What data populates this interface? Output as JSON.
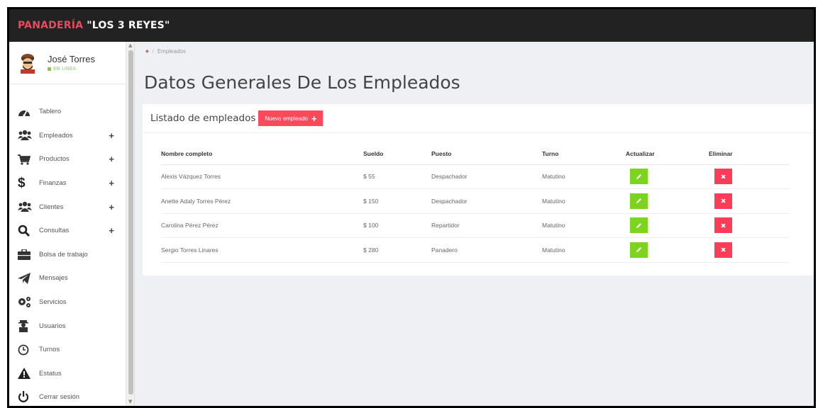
{
  "app": {
    "brand_part1": "PANADERÍA ",
    "brand_part2": "\"LOS 3 REYES\""
  },
  "user": {
    "name": "José Torres",
    "status": "EN LINEA"
  },
  "menu": [
    {
      "label": "Tablero",
      "icon": "dashboard-icon",
      "expandable": false
    },
    {
      "label": "Empleados",
      "icon": "users-icon",
      "expandable": true
    },
    {
      "label": "Productos",
      "icon": "cart-icon",
      "expandable": true
    },
    {
      "label": "Finanzas",
      "icon": "dollar-icon",
      "expandable": true
    },
    {
      "label": "Clientes",
      "icon": "users-icon",
      "expandable": true
    },
    {
      "label": "Consultas",
      "icon": "search-icon",
      "expandable": true
    },
    {
      "label": "Bolsa de trabajo",
      "icon": "briefcase-icon",
      "expandable": false
    },
    {
      "label": "Mensajes",
      "icon": "paper-plane-icon",
      "expandable": false
    },
    {
      "label": "Servicios",
      "icon": "cogs-icon",
      "expandable": false
    },
    {
      "label": "Usuarios",
      "icon": "user-icon",
      "expandable": false
    },
    {
      "label": "Turnos",
      "icon": "clock-icon",
      "expandable": false
    },
    {
      "label": "Estatus",
      "icon": "warning-icon",
      "expandable": false
    },
    {
      "label": "Cerrar sesión",
      "icon": "power-icon",
      "expandable": false
    }
  ],
  "breadcrumb": {
    "current": "Empleados"
  },
  "page": {
    "title": "Datos Generales De Los Empleados"
  },
  "card": {
    "title": "Listado de empleados",
    "new_button": "Nuevo empleado"
  },
  "table": {
    "headers": [
      "Nombre completo",
      "Sueldo",
      "Puesto",
      "Turno",
      "Actualizar",
      "Eliminar"
    ],
    "rows": [
      [
        "Alexis Vázquez Torres",
        "$ 55",
        "Despachador",
        "Matutino"
      ],
      [
        "Anette Adaly Torres Pérez",
        "$ 150",
        "Despachador",
        "Matutino"
      ],
      [
        "Carolina Pérez Pérez",
        "$ 100",
        "Repartidor",
        "Matutino"
      ],
      [
        "Sergio Torres Linares",
        "$ 280",
        "Panadero",
        "Matutino"
      ]
    ]
  },
  "colors": {
    "brand_red": "#e84a5f",
    "topbar": "#222222",
    "edit_green": "#7ed321",
    "delete_red": "#ff3c57",
    "online_green": "#8fc63f"
  }
}
